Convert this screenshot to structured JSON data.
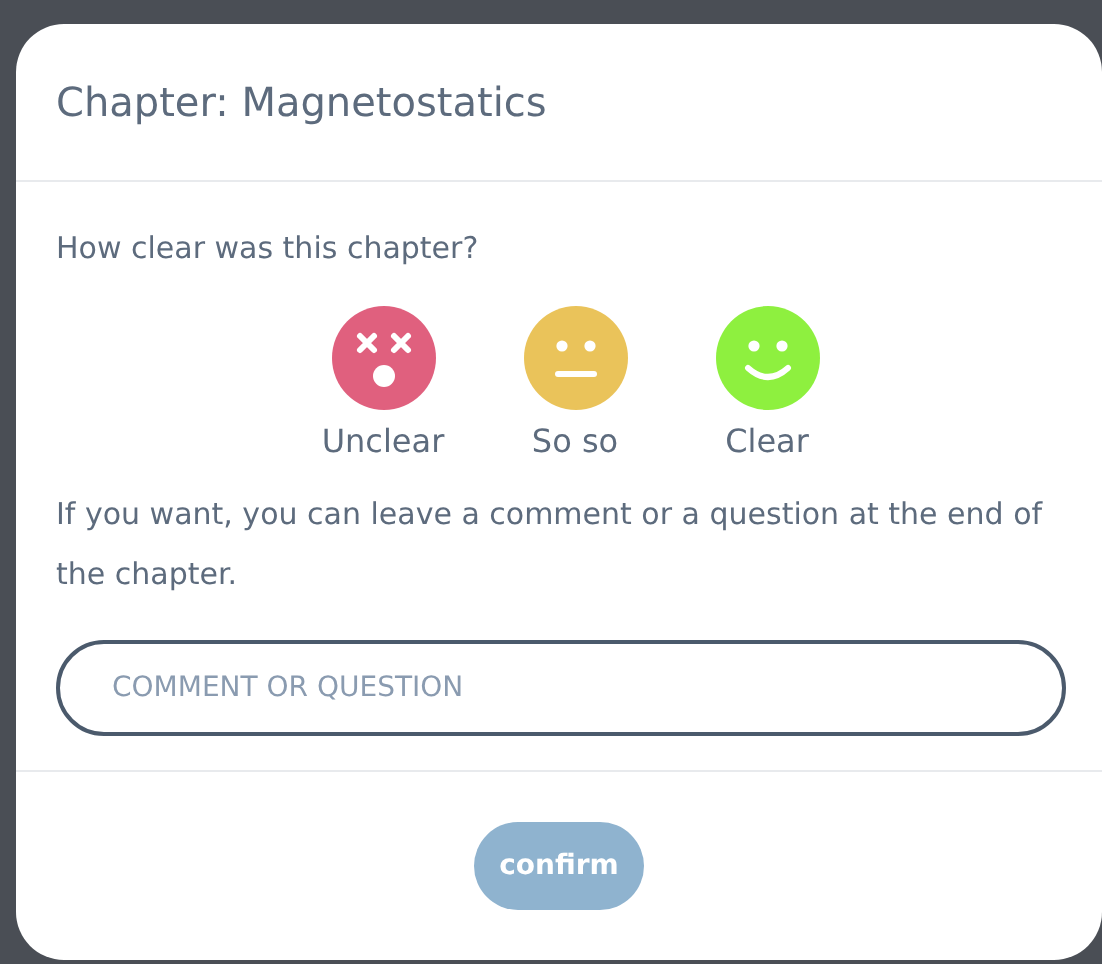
{
  "dialog": {
    "title": "Chapter: Magnetostatics"
  },
  "question": "How clear was this chapter?",
  "ratings": [
    {
      "kind": "unclear",
      "label": "Unclear",
      "color": "#e0607e"
    },
    {
      "kind": "soso",
      "label": "So so",
      "color": "#eac35a"
    },
    {
      "kind": "clear",
      "label": "Clear",
      "color": "#8ef03f"
    }
  ],
  "hint": "If you want, you can leave a comment or a question at the end of the chapter.",
  "comment": {
    "placeholder": "COMMENT OR QUESTION"
  },
  "confirm": {
    "label": "confirm",
    "disabled": true
  }
}
